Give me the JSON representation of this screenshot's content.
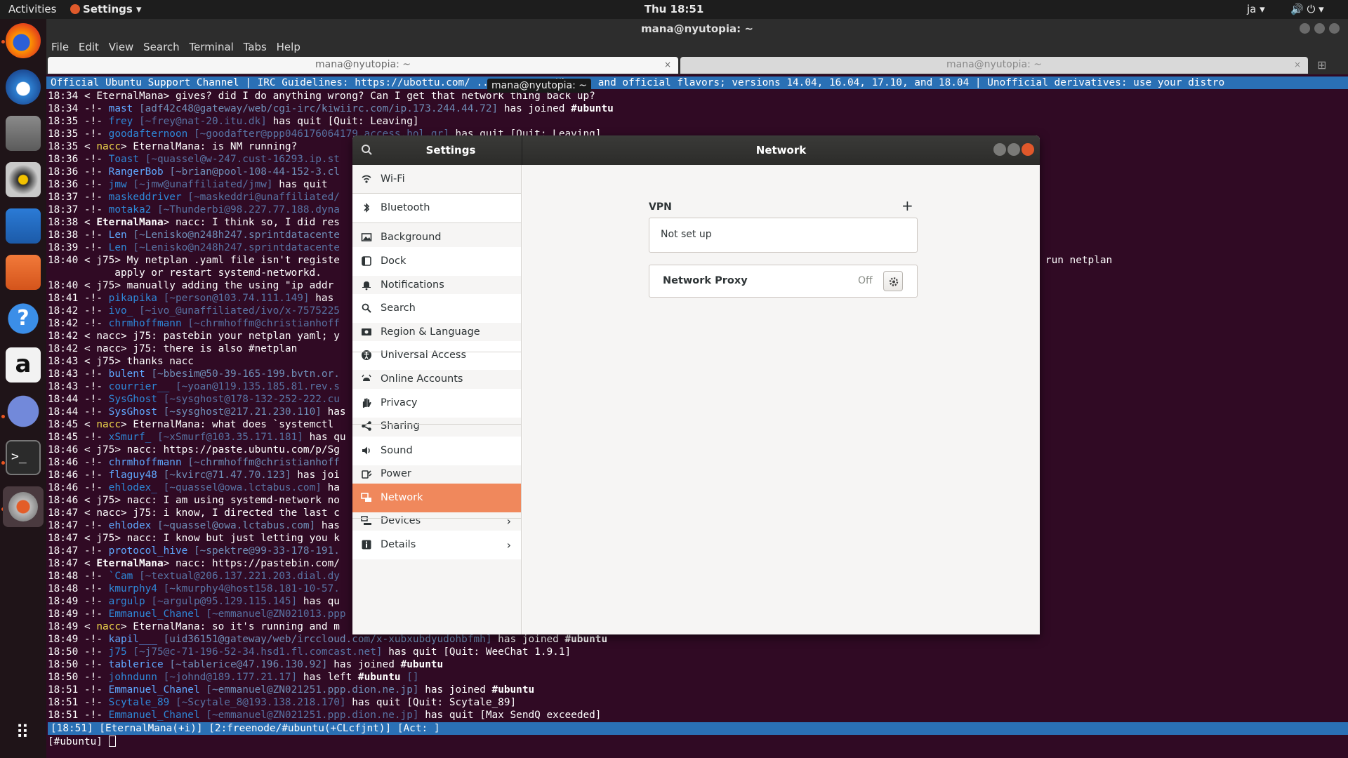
{
  "topbar": {
    "activities": "Activities",
    "app_menu": "Settings ▾",
    "clock": "Thu 18:51",
    "language": "ja ▾",
    "tray": "🔊 ⏻ ▾"
  },
  "dock": {
    "items": [
      "firefox-icon",
      "thunderbird-icon",
      "files-icon",
      "rhythmbox-icon",
      "libreoffice-writer-icon",
      "ubuntu-software-icon",
      "help-icon",
      "amazon-icon",
      "discord-icon",
      "terminal-icon",
      "settings-icon",
      "show-apps-icon"
    ]
  },
  "terminal": {
    "title": "mana@nyutopia: ~",
    "menu": [
      "File",
      "Edit",
      "View",
      "Search",
      "Terminal",
      "Tabs",
      "Help"
    ],
    "tabs": [
      {
        "label": "mana@nyutopia: ~",
        "close": "×"
      },
      {
        "label": "mana@nyutopia: ~",
        "close": "×"
      }
    ],
    "tooltip": "mana@nyutopia: ~",
    "topic": "Official Ubuntu Support Channel | IRC Guidelines: https://ubottu.com/ ... supports Ubuntu and official flavors; versions 14.04, 16.04, 17.10, and 18.04 | Unofficial derivatives: use your distro",
    "lines": [
      {
        "t": "18:34",
        "k": "msg",
        "n": "EternalMana",
        "x": "gives? did I do anything wrong? Can I get that network thing back up?"
      },
      {
        "t": "18:34",
        "k": "join",
        "n": "mast",
        "h": "[adf42c48@gateway/web/cgi-irc/kiwiirc.com/ip.173.244.44.72]",
        "x": "has joined",
        "c": "#ubuntu"
      },
      {
        "t": "18:35",
        "k": "quit",
        "n": "frey",
        "h": "[~frey@nat-20.itu.dk]",
        "x": "has quit [Quit: Leaving]"
      },
      {
        "t": "18:35",
        "k": "quit",
        "n": "goodafternoon",
        "h": "[~goodafter@ppp046176064179.access.hol.gr]",
        "x": "has quit [Quit: Leaving]"
      },
      {
        "t": "18:35",
        "k": "msg-hl",
        "n": "nacc",
        "x": "EternalMana: is NM running?"
      },
      {
        "t": "18:36",
        "k": "quit",
        "n": "Toast",
        "h": "[~quassel@w-247.cust-16293.ip.st",
        "x": ""
      },
      {
        "t": "18:36",
        "k": "join",
        "n": "RangerBob",
        "h": "[~brian@pool-108-44-152-3.cl",
        "x": ""
      },
      {
        "t": "18:36",
        "k": "quit",
        "n": "jmw",
        "h": "[~jmw@unaffiliated/jmw]",
        "x": "has quit"
      },
      {
        "t": "18:37",
        "k": "quit",
        "n": "maskeddriver",
        "h": "[~maskeddri@unaffiliated/",
        "x": ""
      },
      {
        "t": "18:37",
        "k": "quit",
        "n": "motaka2",
        "h": "[~Thunderbi@98.227.77.188.dyna",
        "x": ""
      },
      {
        "t": "18:38",
        "k": "msg-self",
        "n": "EternalMana",
        "x": "nacc: I think so, I did res"
      },
      {
        "t": "18:38",
        "k": "join",
        "n": "Len",
        "h": "[~Lenisko@n248h247.sprintdatacente",
        "x": ""
      },
      {
        "t": "18:39",
        "k": "quit",
        "n": "Len",
        "h": "[~Lenisko@n248h247.sprintdatacente",
        "x": ""
      },
      {
        "t": "18:40",
        "k": "msg",
        "n": "j75",
        "x": "My netplan .yaml file isn't registe                                                                                  sn't update \"ip addr\" list when I run netplan"
      },
      {
        "t": "",
        "k": "cont",
        "x": "           apply or restart systemd-networkd."
      },
      {
        "t": "18:40",
        "k": "msg",
        "n": "j75",
        "x": "manually adding the using \"ip addr"
      },
      {
        "t": "18:41",
        "k": "quit",
        "n": "pikapika",
        "h": "[~person@103.74.111.149]",
        "x": "has"
      },
      {
        "t": "18:42",
        "k": "quit",
        "n": "ivo_",
        "h": "[~ivo_@unaffiliated/ivo/x-7575225",
        "x": ""
      },
      {
        "t": "18:42",
        "k": "quit",
        "n": "chrmhoffmann",
        "h": "[~chrmhoffm@christianhoff",
        "x": ""
      },
      {
        "t": "18:42",
        "k": "msg",
        "n": "nacc",
        "x": "j75: pastebin your netplan yaml; y"
      },
      {
        "t": "18:42",
        "k": "msg",
        "n": "nacc",
        "x": "j75: there is also #netplan"
      },
      {
        "t": "18:43",
        "k": "msg",
        "n": "j75",
        "x": "thanks nacc"
      },
      {
        "t": "18:43",
        "k": "join",
        "n": "bulent",
        "h": "[~bbesim@50-39-165-199.bvtn.or.",
        "x": ""
      },
      {
        "t": "18:43",
        "k": "quit",
        "n": "courrier__",
        "h": "[~yoan@119.135.185.81.rev.s",
        "x": ""
      },
      {
        "t": "18:44",
        "k": "quit",
        "n": "SysGhost",
        "h": "[~sysghost@178-132-252-222.cu",
        "x": ""
      },
      {
        "t": "18:44",
        "k": "join",
        "n": "SysGhost",
        "h": "[~sysghost@217.21.230.110]",
        "x": "has"
      },
      {
        "t": "18:45",
        "k": "msg-hl",
        "n": "nacc",
        "x": "EternalMana: what does `systemctl"
      },
      {
        "t": "18:45",
        "k": "quit",
        "n": "xSmurf_",
        "h": "[~xSmurf@103.35.171.181]",
        "x": "has qu"
      },
      {
        "t": "18:46",
        "k": "msg",
        "n": "j75",
        "x": "nacc: https://paste.ubuntu.com/p/Sg"
      },
      {
        "t": "18:46",
        "k": "join",
        "n": "chrmhoffmann",
        "h": "[~chrmhoffm@christianhoff",
        "x": ""
      },
      {
        "t": "18:46",
        "k": "join",
        "n": "flaguy48",
        "h": "[~kvirc@71.47.70.123]",
        "x": "has joi"
      },
      {
        "t": "18:46",
        "k": "quit",
        "n": "ehlodex_",
        "h": "[~quassel@owa.lctabus.com]",
        "x": "ha"
      },
      {
        "t": "18:46",
        "k": "msg",
        "n": "j75",
        "x": "nacc: I am using systemd-network no"
      },
      {
        "t": "18:47",
        "k": "msg",
        "n": "nacc",
        "x": "j75: i know, I directed the last c"
      },
      {
        "t": "18:47",
        "k": "join",
        "n": "ehlodex",
        "h": "[~quassel@owa.lctabus.com]",
        "x": "has"
      },
      {
        "t": "18:47",
        "k": "msg",
        "n": "j75",
        "x": "nacc: I know but just letting you k"
      },
      {
        "t": "18:47",
        "k": "join",
        "n": "protocol_hive",
        "h": "[~spektre@99-33-178-191.",
        "x": ""
      },
      {
        "t": "18:47",
        "k": "msg-self",
        "n": "EternalMana",
        "x": "nacc: https://pastebin.com/"
      },
      {
        "t": "18:48",
        "k": "quit",
        "n": "`Cam",
        "h": "[~textual@206.137.221.203.dial.dy",
        "x": ""
      },
      {
        "t": "18:48",
        "k": "quit",
        "n": "kmurphy4",
        "h": "[~kmurphy4@host158.181-10-57.",
        "x": ""
      },
      {
        "t": "18:49",
        "k": "quit",
        "n": "argulp",
        "h": "[~argulp@95.129.115.145]",
        "x": "has qu"
      },
      {
        "t": "18:49",
        "k": "quit",
        "n": "Emmanuel_Chanel",
        "h": "[~emmanuel@ZN021013.ppp",
        "x": ""
      },
      {
        "t": "18:49",
        "k": "msg-hl",
        "n": "nacc",
        "x": "EternalMana: so it's running and m"
      },
      {
        "t": "18:49",
        "k": "join",
        "n": "kapil___",
        "h": "[uid36151@gateway/web/irccloud.com/x-xubxubdyudohbfmh]",
        "x": "has joined",
        "c": "#ubuntu"
      },
      {
        "t": "18:50",
        "k": "quit",
        "n": "j75",
        "h": "[~j75@c-71-196-52-34.hsd1.fl.comcast.net]",
        "x": "has quit [Quit: WeeChat 1.9.1]"
      },
      {
        "t": "18:50",
        "k": "join",
        "n": "tablerice",
        "h": "[~tablerice@47.196.130.92]",
        "x": "has joined",
        "c": "#ubuntu"
      },
      {
        "t": "18:50",
        "k": "quit",
        "n": "johndunn",
        "h": "[~johnd@189.177.21.17]",
        "x": "has left",
        "c": "#ubuntu",
        "y": " []"
      },
      {
        "t": "18:51",
        "k": "join",
        "n": "Emmanuel_Chanel",
        "h": "[~emmanuel@ZN021251.ppp.dion.ne.jp]",
        "x": "has joined",
        "c": "#ubuntu"
      },
      {
        "t": "18:51",
        "k": "quit",
        "n": "Scytale_89",
        "h": "[~Scytale_8@193.138.218.170]",
        "x": "has quit [Quit: Scytale_89]"
      },
      {
        "t": "18:51",
        "k": "quit",
        "n": "Emmanuel_Chanel",
        "h": "[~emmanuel@ZN021251.ppp.dion.ne.jp]",
        "x": "has quit [Max SendQ exceeded]"
      }
    ],
    "status_bar": "[18:51] [EternalMana(+i)] [2:freenode/#ubuntu(+CLcfjnt)] [Act: ]",
    "prompt": "[#ubuntu] "
  },
  "settings": {
    "title": "Settings",
    "panel_title": "Network",
    "sidebar": [
      {
        "label": "Wi-Fi",
        "icon": "wifi-icon"
      },
      {
        "label": "Bluetooth",
        "icon": "bluetooth-icon"
      },
      {
        "label": "Background",
        "icon": "background-icon"
      },
      {
        "label": "Dock",
        "icon": "dock-icon"
      },
      {
        "label": "Notifications",
        "icon": "bell-icon"
      },
      {
        "label": "Search",
        "icon": "search-icon"
      },
      {
        "label": "Region & Language",
        "icon": "flag-icon"
      },
      {
        "label": "Universal Access",
        "icon": "accessibility-icon"
      },
      {
        "label": "Online Accounts",
        "icon": "online-accounts-icon"
      },
      {
        "label": "Privacy",
        "icon": "hand-icon"
      },
      {
        "label": "Sharing",
        "icon": "share-icon"
      },
      {
        "label": "Sound",
        "icon": "speaker-icon"
      },
      {
        "label": "Power",
        "icon": "power-icon"
      },
      {
        "label": "Network",
        "icon": "network-icon",
        "active": true
      },
      {
        "label": "Devices",
        "icon": "devices-icon",
        "chevron": "›"
      },
      {
        "label": "Details",
        "icon": "info-icon",
        "chevron": "›"
      }
    ],
    "vpn": {
      "heading": "VPN",
      "add": "+",
      "status": "Not set up"
    },
    "proxy": {
      "label": "Network Proxy",
      "state": "Off"
    },
    "colors": {
      "accent": "#f0885c",
      "close": "#e0582b"
    }
  }
}
